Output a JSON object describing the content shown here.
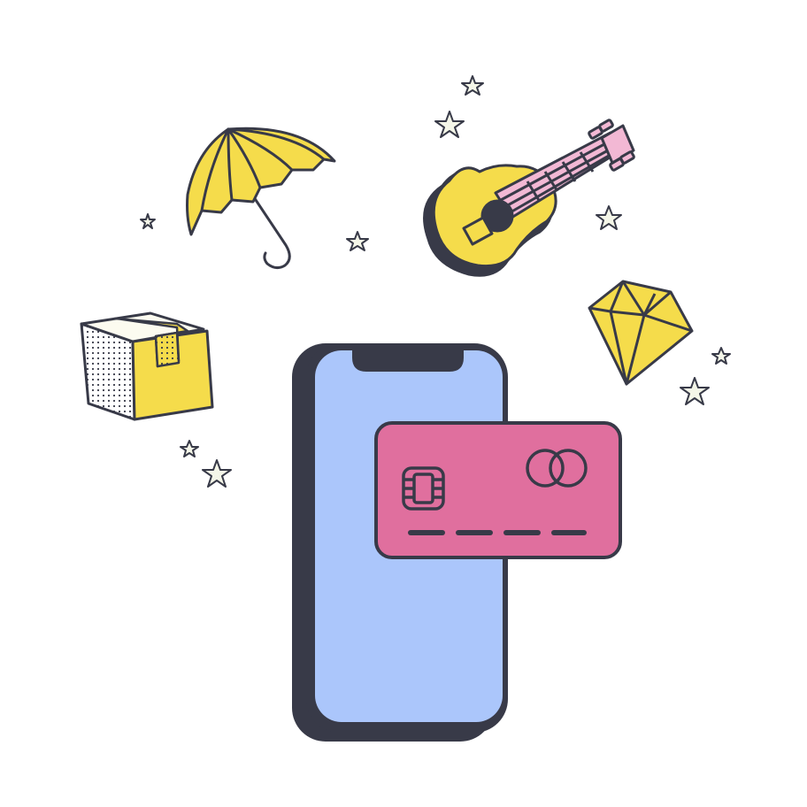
{
  "illustration": {
    "palette": {
      "outline": "#383a48",
      "phone_screen": "#abc6fb",
      "card": "#e06f9e",
      "yellow": "#f5dc4b",
      "pink": "#f2b8d4",
      "star_fill": "#f4f6e8",
      "background": "#ffffff"
    },
    "objects": {
      "phone": "smartphone-icon",
      "card": "credit-card-icon",
      "card_chip": "chip-icon",
      "card_logo": "card-network-logo-icon",
      "umbrella": "umbrella-icon",
      "guitar": "ukulele-icon",
      "diamond": "diamond-icon",
      "box": "package-box-icon",
      "stars": "sparkle-star-icon"
    }
  }
}
